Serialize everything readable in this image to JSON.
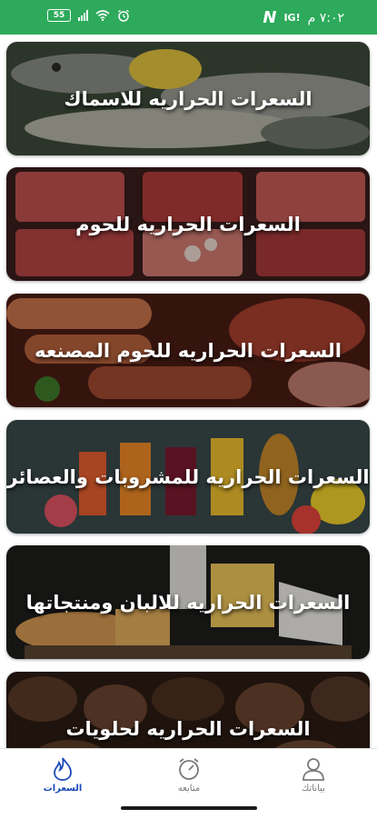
{
  "status_bar": {
    "time": "٧:٠٢ م",
    "battery": "55",
    "network_label": "N",
    "ig_indicator": "IG!"
  },
  "categories": [
    {
      "label": "السعرات الحراريه للاسماك",
      "image": "fish"
    },
    {
      "label": "السعرات الحراريه للحوم",
      "image": "meat"
    },
    {
      "label": "السعرات الحراريه للحوم المصنعه",
      "image": "sausages"
    },
    {
      "label": "السعرات الحراريه للمشروبات والعصائر",
      "image": "juices"
    },
    {
      "label": "السعرات الحراريه للالبان ومنتجاتها",
      "image": "cheese"
    },
    {
      "label": "السعرات الحراريه لحلويات",
      "image": "chocolates"
    }
  ],
  "bottom_nav": [
    {
      "label": "بياناتك",
      "icon": "user-icon",
      "active": false
    },
    {
      "label": "متابعه",
      "icon": "stopwatch-icon",
      "active": false
    },
    {
      "label": "السعرات",
      "icon": "flame-icon",
      "active": true
    }
  ],
  "colors": {
    "status_bar": "#2daa5b",
    "active_nav": "#1b49b8",
    "inactive_nav": "#7a7a7a"
  }
}
